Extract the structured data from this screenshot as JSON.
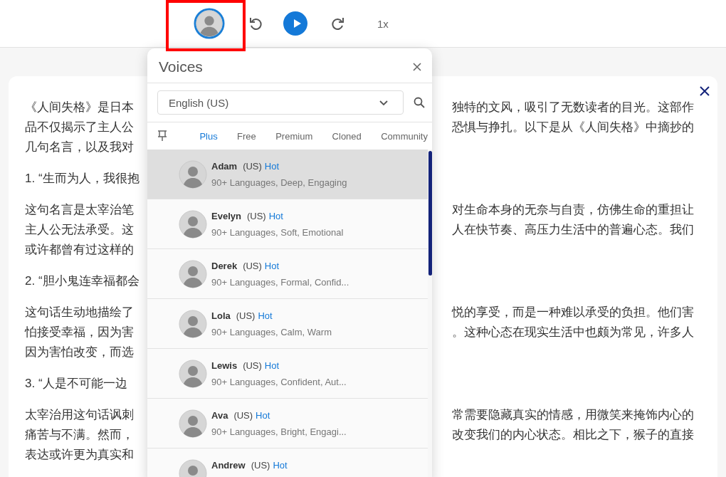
{
  "player": {
    "speed": "1x",
    "highlighted": true
  },
  "article": {
    "paragraphs": [
      {
        "lines": [
          {
            "left": "《人间失格》是日本",
            "right": "独特的文风，吸引了无数读者的目光。这部作"
          },
          {
            "left": "品不仅揭示了主人公",
            "right": "恐惧与挣扎。以下是从《人间失格》中摘抄的"
          },
          {
            "left": "几句名言，以及我对"
          }
        ]
      },
      {
        "lines": [
          {
            "left": "1. “生而为人，我很抱"
          }
        ]
      },
      {
        "lines": [
          {
            "left": "这句名言是太宰治笔",
            "right": "对生命本身的无奈与自责，仿佛生命的重担让"
          },
          {
            "left": "主人公无法承受。这",
            "right": "人在快节奏、高压力生活中的普遍心态。我们"
          },
          {
            "left": "或许都曾有过这样的"
          }
        ]
      },
      {
        "lines": [
          {
            "left": "2. “胆小鬼连幸福都会"
          }
        ]
      },
      {
        "lines": [
          {
            "left": "这句话生动地描绘了",
            "right": "悦的享受，而是一种难以承受的负担。他们害"
          },
          {
            "left": "怕接受幸福，因为害",
            "right": "。这种心态在现实生活中也颇为常见，许多人"
          },
          {
            "left": "因为害怕改变，而选"
          }
        ]
      },
      {
        "lines": [
          {
            "left": "3. “人是不可能一边"
          }
        ]
      },
      {
        "lines": [
          {
            "left": "太宰治用这句话讽刺",
            "right": "常需要隐藏真实的情感，用微笑来掩饰内心的"
          },
          {
            "left": "痛苦与不满。然而，",
            "right": "改变我们的内心状态。相比之下，猴子的直接"
          },
          {
            "left": "表达或许更为真实和"
          }
        ]
      }
    ]
  },
  "voices_panel": {
    "title": "Voices",
    "language": "English (US)",
    "tabs": [
      {
        "label": "Plus",
        "selected": true
      },
      {
        "label": "Free",
        "selected": false
      },
      {
        "label": "Premium",
        "selected": false
      },
      {
        "label": "Cloned",
        "selected": false
      },
      {
        "label": "Community",
        "selected": false
      }
    ],
    "voices": [
      {
        "name": "Adam",
        "region": "(US)",
        "badge": "Hot",
        "description": "90+ Languages, Deep, Engaging",
        "selected": true
      },
      {
        "name": "Evelyn",
        "region": "(US)",
        "badge": "Hot",
        "description": "90+ Languages, Soft, Emotional",
        "selected": false
      },
      {
        "name": "Derek",
        "region": "(US)",
        "badge": "Hot",
        "description": "90+ Languages, Formal, Confid...",
        "selected": false
      },
      {
        "name": "Lola",
        "region": "(US)",
        "badge": "Hot",
        "description": "90+ Languages, Calm, Warm",
        "selected": false
      },
      {
        "name": "Lewis",
        "region": "(US)",
        "badge": "Hot",
        "description": "90+ Languages, Confident, Aut...",
        "selected": false
      },
      {
        "name": "Ava",
        "region": "(US)",
        "badge": "Hot",
        "description": "90+ Languages, Bright, Engagi...",
        "selected": false
      },
      {
        "name": "Andrew",
        "region": "(US)",
        "badge": "Hot",
        "selected": false
      }
    ]
  }
}
